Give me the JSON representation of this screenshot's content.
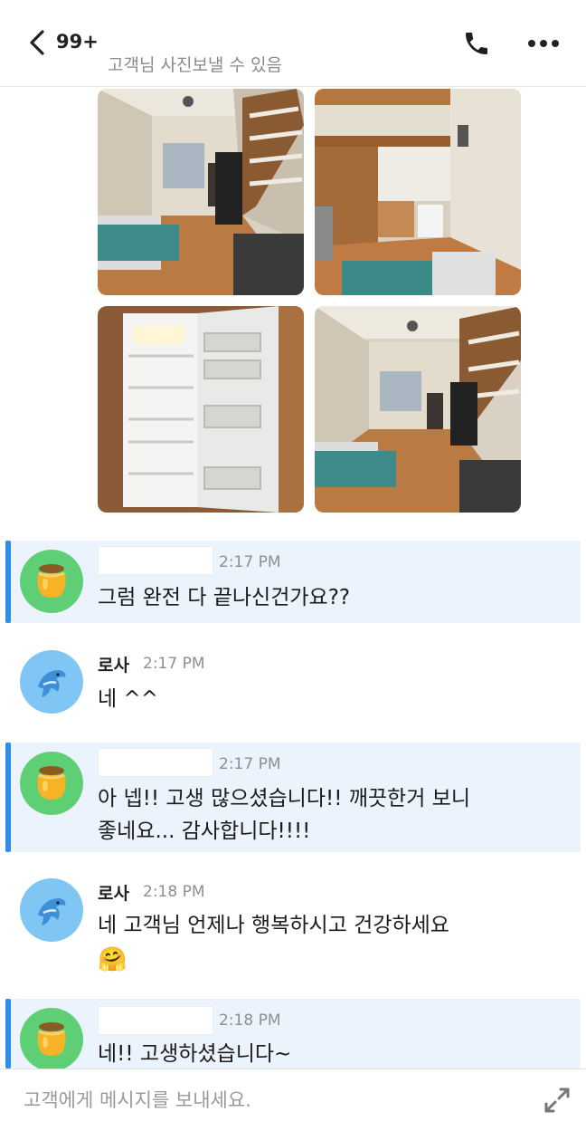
{
  "header": {
    "unread_count": "99+",
    "subtitle": "고객님 사진보낼 수 있음"
  },
  "messages": [
    {
      "time": "2:17 PM",
      "text": "그럼 완전 다 끝나신건가요??"
    },
    {
      "sender": "로사",
      "time": "2:17 PM",
      "text": "네 ^^"
    },
    {
      "time": "2:17 PM",
      "line1": "아 넵!! 고생 많으셨습니다!! 깨끗한거 보니",
      "line2": "좋네요... 감사합니다!!!!"
    },
    {
      "sender": "로사",
      "time": "2:18 PM",
      "text": "네 고객님 언제나 행복하시고 건강하세요",
      "emoji": "🤗"
    },
    {
      "time": "2:18 PM",
      "text": "네!! 고생하셨습니다~"
    }
  ],
  "input": {
    "placeholder": "고객에게 메시지를 보내세요."
  },
  "colors": {
    "accent": "#2f8fe8",
    "self_bubble": "#ebf4fc",
    "honey_avatar": "#5fcf76",
    "dolphin_avatar": "#7fc6f4"
  },
  "icons": [
    "back-chevron-icon",
    "phone-icon",
    "more-icon",
    "honey-jar-icon",
    "dolphin-icon",
    "expand-icon"
  ]
}
